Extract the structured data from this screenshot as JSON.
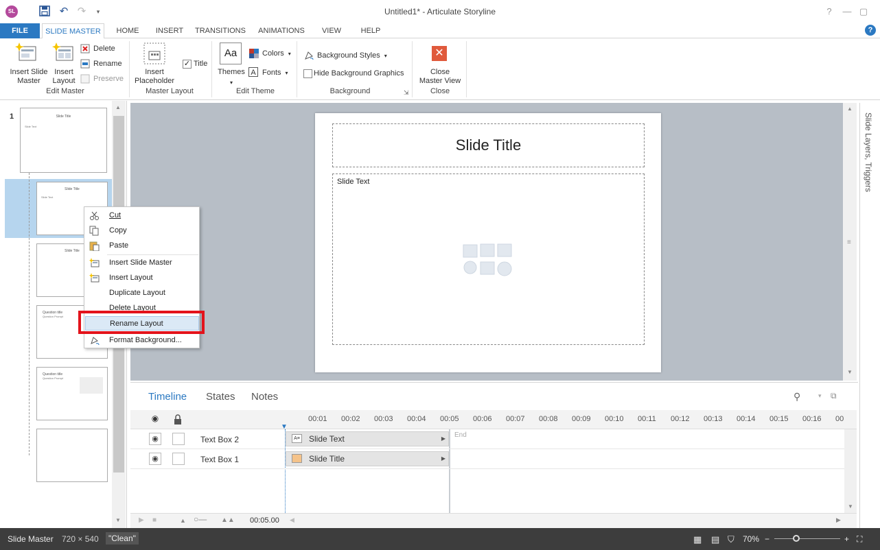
{
  "window": {
    "title": "Untitled1* -  Articulate Storyline",
    "logo_text": "SL"
  },
  "tabs": [
    "FILE",
    "SLIDE MASTER",
    "HOME",
    "INSERT",
    "TRANSITIONS",
    "ANIMATIONS",
    "VIEW",
    "HELP"
  ],
  "ribbon": {
    "edit_master": {
      "label": "Edit Master",
      "insert_slide_master": "Insert Slide\nMaster",
      "insert_layout": "Insert\nLayout",
      "delete": "Delete",
      "rename": "Rename",
      "preserve": "Preserve"
    },
    "master_layout": {
      "label": "Master Layout",
      "insert_placeholder": "Insert\nPlaceholder",
      "title_checkbox": "Title",
      "title_checked": true
    },
    "edit_theme": {
      "label": "Edit Theme",
      "themes": "Themes",
      "themes_icon_text": "Aa",
      "colors": "Colors",
      "fonts": "Fonts"
    },
    "background": {
      "label": "Background",
      "styles": "Background Styles",
      "hide_graphics": "Hide Background Graphics"
    },
    "close": {
      "label": "Close",
      "close_master_view": "Close\nMaster View"
    }
  },
  "slide_panel": {
    "slide_number": "1",
    "thumbs": [
      {
        "title": "Slide Title",
        "text": "Slide Text"
      },
      {
        "title": "Slide Title",
        "text": "Slide Text"
      },
      {
        "title": "Slide Title",
        "text": ""
      },
      {
        "title": "Question title",
        "text": "Question Prompt"
      },
      {
        "title": "Question title",
        "text": "Question Prompt"
      },
      {
        "title": "",
        "text": ""
      }
    ]
  },
  "slide": {
    "title": "Slide Title",
    "body": "Slide Text"
  },
  "right_panel": {
    "label": "Slide Layers, Triggers"
  },
  "timeline": {
    "tabs": [
      "Timeline",
      "States",
      "Notes"
    ],
    "ticks": [
      "00:01",
      "00:02",
      "00:03",
      "00:04",
      "00:05",
      "00:06",
      "00:07",
      "00:08",
      "00:09",
      "00:10",
      "00:11",
      "00:12",
      "00:13",
      "00:14",
      "00:15",
      "00:16",
      "00"
    ],
    "rows": [
      {
        "name": "Text Box 2",
        "bar": "Slide Text"
      },
      {
        "name": "Text Box 1",
        "bar": "Slide Title"
      }
    ],
    "end_label": "End",
    "duration": "00:05.00"
  },
  "status_bar": {
    "mode": "Slide Master",
    "size": "720 × 540",
    "theme": "\"Clean\"",
    "zoom": "70%"
  },
  "context_menu": {
    "items": [
      "Cut",
      "Copy",
      "Paste",
      "Insert Slide Master",
      "Insert Layout",
      "Duplicate Layout",
      "Delete Layout",
      "Rename Layout",
      "Format Background..."
    ],
    "highlighted": "Rename Layout"
  },
  "colors": {
    "accent": "#2b79c2",
    "highlight_box": "#e3131b",
    "status_bar": "#3d3d3d"
  }
}
